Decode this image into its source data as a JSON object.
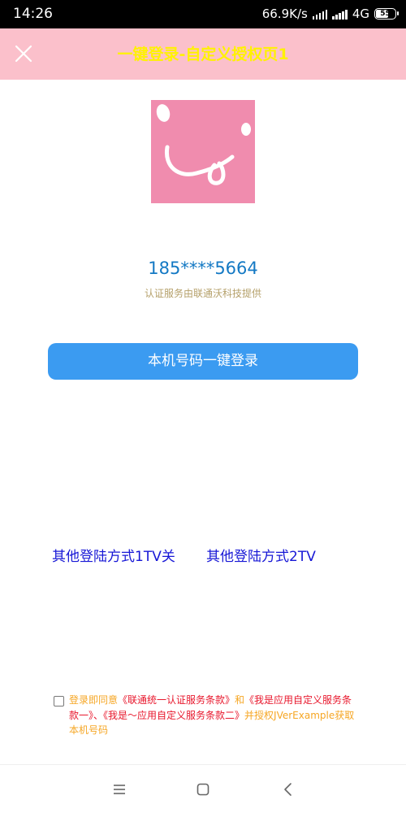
{
  "status_bar": {
    "time": "14:26",
    "network_speed": "66.9K/s",
    "network_type": "4G",
    "battery": "55"
  },
  "title_bar": {
    "title": "一键登录-自定义授权页1",
    "background_color": "#fbc0cb",
    "title_color": "#fff200",
    "close_icon": "close-icon"
  },
  "main": {
    "logo_icon": "app-logo-icon",
    "phone_number": "185****5664",
    "auth_provider_text": "认证服务由联通沃科技提供",
    "login_button_label": "本机号码一键登录",
    "login_button_color": "#3b9bf1",
    "alt_login_1": "其他登陆方式1TV关",
    "alt_login_2": "其他登陆方式2TV"
  },
  "agreement": {
    "checked": false,
    "prefix": "登录即同意",
    "terms_1": "《联通统一认证服务条款》",
    "and": "和",
    "terms_2": "《我是应用自定义服务条款一》",
    "separator": "、",
    "terms_3": "《我是～应用自定义服务条款二》",
    "suffix": "并授权JVerExample获取本机号码",
    "text_color": "#f6a623",
    "link_color": "#e8172c"
  },
  "nav_bar": {
    "menu_icon": "menu-icon",
    "home_icon": "home-icon",
    "back_icon": "back-icon"
  }
}
